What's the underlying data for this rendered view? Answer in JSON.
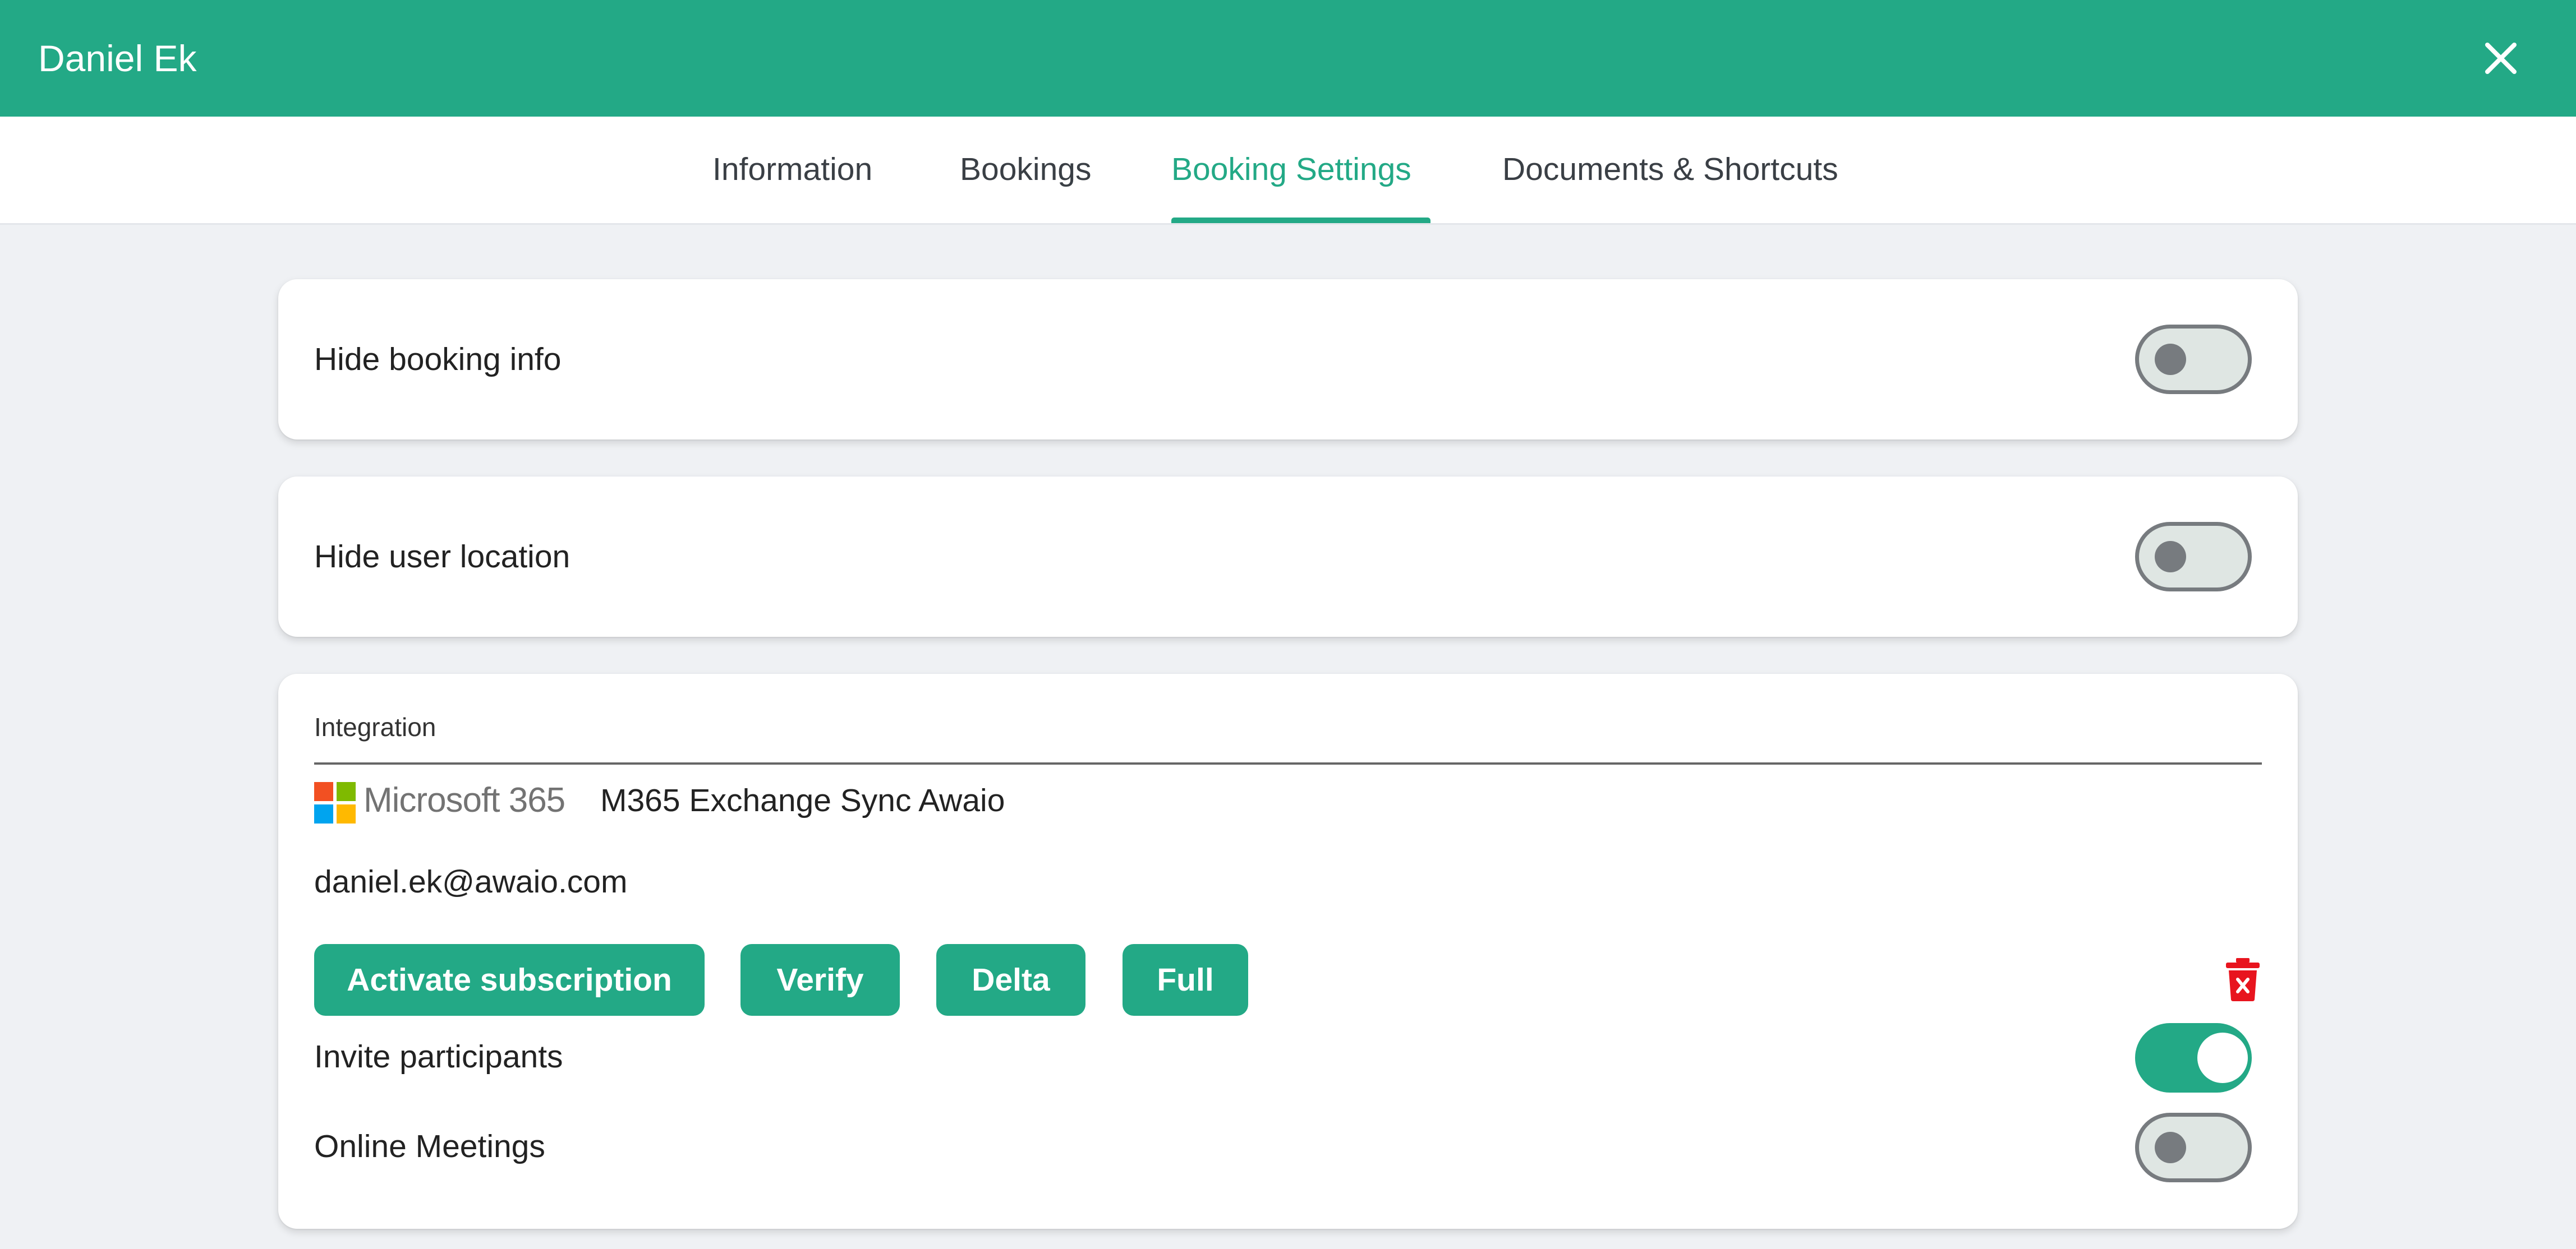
{
  "window": {
    "title": "Daniel Ek",
    "close_icon": "close-icon"
  },
  "tabs": [
    {
      "label": "Information",
      "active": false
    },
    {
      "label": "Bookings",
      "active": false
    },
    {
      "label": "Booking Settings",
      "active": true
    },
    {
      "label": "Documents & Shortcuts",
      "active": false
    }
  ],
  "settings": {
    "hide_booking_info": {
      "label": "Hide booking info",
      "enabled": false
    },
    "hide_user_location": {
      "label": "Hide user location",
      "enabled": false
    }
  },
  "integration": {
    "title": "Integration",
    "provider_logo_text": "Microsoft 365",
    "sync_name": "M365 Exchange Sync Awaio",
    "email": "daniel.ek@awaio.com",
    "buttons": {
      "activate": "Activate subscription",
      "verify": "Verify",
      "delta": "Delta",
      "full": "Full"
    },
    "delete_icon": "trash-delete-icon",
    "invite_participants": {
      "label": "Invite participants",
      "enabled": true
    },
    "online_meetings": {
      "label": "Online Meetings",
      "enabled": false
    }
  },
  "colors": {
    "brand": "#23a986",
    "background": "#eff1f4",
    "danger": "#e8141e",
    "ms_red": "#f25022",
    "ms_green": "#7fba00",
    "ms_blue": "#00a4ef",
    "ms_yellow": "#ffb900"
  }
}
